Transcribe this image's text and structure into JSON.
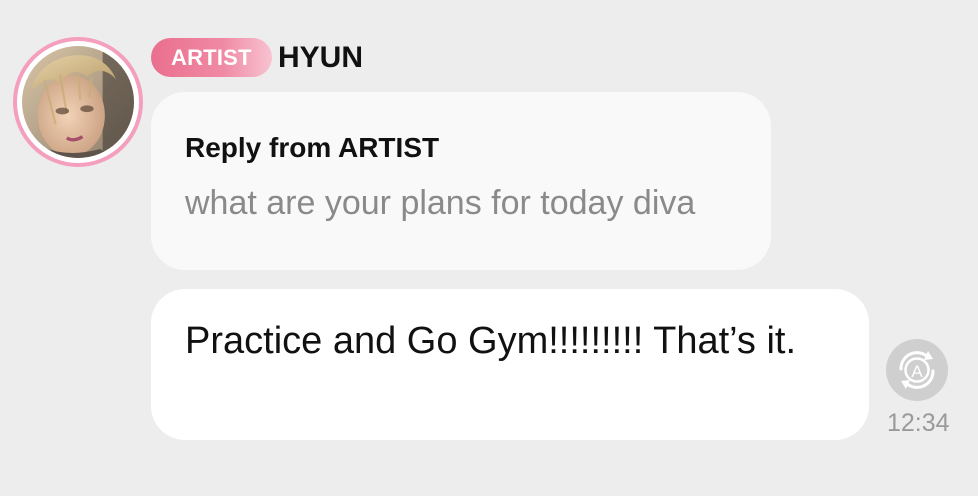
{
  "sender": {
    "badge_label": "ARTIST",
    "name": "HYUN",
    "avatar_icon": "profile-photo"
  },
  "reply": {
    "title": "Reply from ARTIST",
    "quoted_text": "what are your plans for today diva"
  },
  "message": {
    "text": "Practice and Go Gym!!!!!!!!! That’s it.",
    "timestamp": "12:34"
  },
  "actions": {
    "translate_icon": "translate-icon"
  },
  "colors": {
    "background": "#ededed",
    "badge_pink": "#ea6f8e",
    "avatar_ring": "#f49fbd",
    "reply_bubble": "#f9f9f9",
    "message_bubble": "#ffffff",
    "muted_text": "#8a8a8a"
  }
}
